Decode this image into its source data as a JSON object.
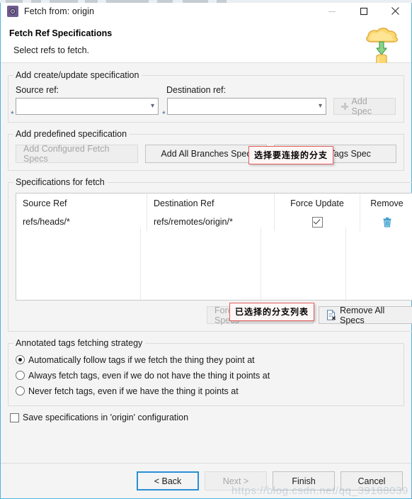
{
  "window": {
    "title": "Fetch from: origin",
    "icon": "eclipse-egit-icon",
    "controls": {
      "minimize": "minimize-icon",
      "maximize": "maximize-icon",
      "close": "close-icon"
    }
  },
  "banner": {
    "title": "Fetch Ref Specifications",
    "subtitle": "Select refs to fetch.",
    "art": "cloud-download-to-database-icon"
  },
  "create_update_group": {
    "legend": "Add create/update specification",
    "source_label": "Source ref:",
    "destination_label": "Destination ref:",
    "source_value": "",
    "source_placeholder": "",
    "destination_value": "",
    "destination_placeholder": "",
    "required_marker": "*",
    "add_spec_label": "Add Spec",
    "add_spec_enabled": false
  },
  "predefined_group": {
    "legend": "Add predefined specification",
    "buttons": [
      {
        "label": "Add Configured Fetch Specs",
        "enabled": false
      },
      {
        "label": "Add All Branches Spec",
        "enabled": true
      },
      {
        "label": "Add All Tags Spec",
        "enabled": true
      }
    ]
  },
  "specifications_group": {
    "legend": "Specifications for fetch",
    "columns": [
      "Source Ref",
      "Destination Ref",
      "Force Update",
      "Remove"
    ],
    "rows": [
      {
        "source_ref": "refs/heads/*",
        "destination_ref": "refs/remotes/origin/*",
        "force_update": true,
        "remove_icon": "trash-icon"
      }
    ],
    "force_update_all_label": "Force Update All Specs",
    "force_update_all_enabled": false,
    "remove_all_label": "Remove All Specs",
    "remove_all_enabled": true,
    "remove_all_icon": "document-delete-icon"
  },
  "tags_group": {
    "legend": "Annotated tags fetching strategy",
    "options": [
      {
        "label": "Automatically follow tags if we fetch the thing they point at",
        "selected": true
      },
      {
        "label": "Always fetch tags, even if we do not have the thing it points at",
        "selected": false
      },
      {
        "label": "Never fetch tags, even if we have the thing it points at",
        "selected": false
      }
    ]
  },
  "save_checkbox": {
    "label": "Save specifications in 'origin' configuration",
    "checked": false
  },
  "footer": {
    "back_label": "< Back",
    "back_enabled": true,
    "next_label": "Next >",
    "next_enabled": false,
    "finish_label": "Finish",
    "finish_enabled": true,
    "cancel_label": "Cancel",
    "cancel_enabled": true
  },
  "annotations": [
    {
      "id": "anno-branch",
      "text": "选择要连接的分支"
    },
    {
      "id": "anno-list",
      "text": "已选择的分支列表"
    }
  ],
  "watermark": "https://blog.csdn.net/qq_39188039",
  "colors": {
    "window_border": "#4db3e0",
    "annotation_border": "#e05b5b",
    "primary_button_border": "#2a8fd4",
    "required_marker": "#4a6b9e",
    "trash_icon": "#3a9ccb"
  }
}
